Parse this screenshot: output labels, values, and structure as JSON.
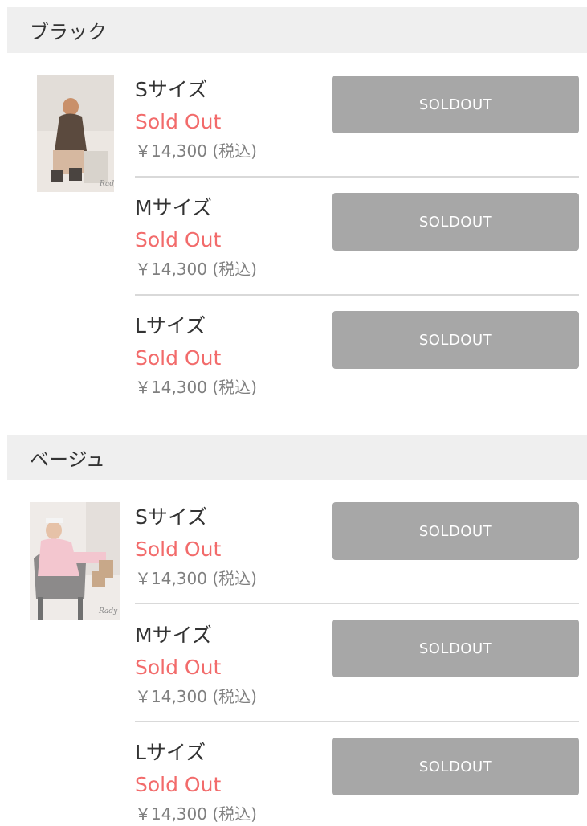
{
  "sections": [
    {
      "color_name": "ブラック",
      "variants": [
        {
          "size": "Sサイズ",
          "status": "Sold Out",
          "price": "￥14,300 (税込)",
          "button": "SOLDOUT"
        },
        {
          "size": "Mサイズ",
          "status": "Sold Out",
          "price": "￥14,300 (税込)",
          "button": "SOLDOUT"
        },
        {
          "size": "Lサイズ",
          "status": "Sold Out",
          "price": "￥14,300 (税込)",
          "button": "SOLDOUT"
        }
      ]
    },
    {
      "color_name": "ベージュ",
      "variants": [
        {
          "size": "Sサイズ",
          "status": "Sold Out",
          "price": "￥14,300 (税込)",
          "button": "SOLDOUT"
        },
        {
          "size": "Mサイズ",
          "status": "Sold Out",
          "price": "￥14,300 (税込)",
          "button": "SOLDOUT"
        },
        {
          "size": "Lサイズ",
          "status": "Sold Out",
          "price": "￥14,300 (税込)",
          "button": "SOLDOUT"
        }
      ]
    }
  ],
  "colors": {
    "header_bg": "#efefef",
    "sold_out_text": "#f26b6b",
    "button_bg": "#a7a7a7",
    "price_text": "#7f7f7f"
  }
}
